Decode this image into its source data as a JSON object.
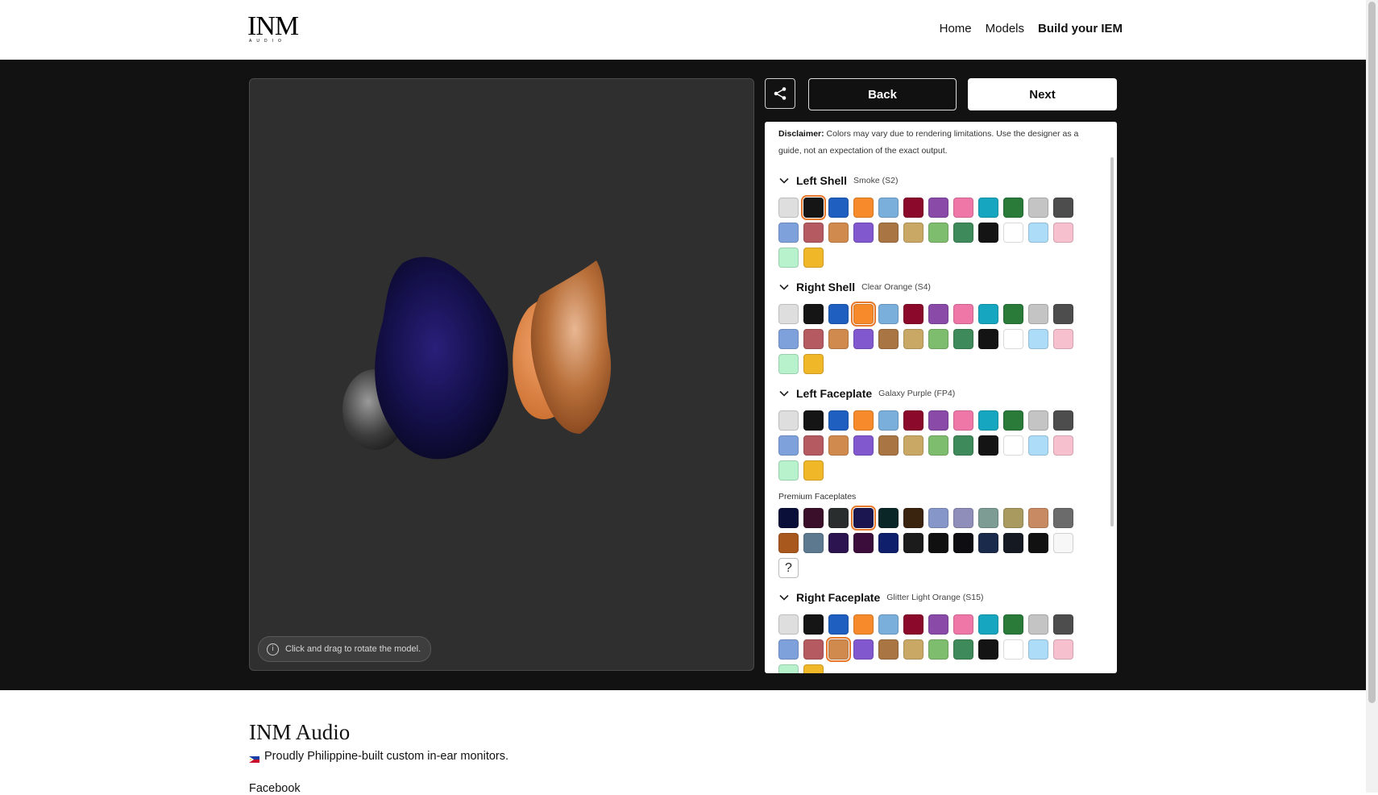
{
  "header": {
    "logo_text": "INM",
    "logo_sub": "AUDIO",
    "nav": [
      "Home",
      "Models",
      "Build your IEM"
    ],
    "active_nav": "Build your IEM"
  },
  "viewer": {
    "hint": "Click and drag to rotate the model."
  },
  "actions": {
    "back": "Back",
    "next": "Next"
  },
  "panel": {
    "disclaimer_label": "Disclaimer:",
    "disclaimer_text": " Colors may vary due to rendering limitations. Use the designer as a guide, not an expectation of the exact output.",
    "premium_label": "Premium Faceplates",
    "premium_unknown": "?",
    "sections": [
      {
        "title": "Left Shell",
        "value": "Smoke (S2)",
        "selected": 1
      },
      {
        "title": "Right Shell",
        "value": "Clear Orange (S4)",
        "selected": 3
      },
      {
        "title": "Left Faceplate",
        "value": "Galaxy Purple (FP4)",
        "premium_selected": 3
      },
      {
        "title": "Right Faceplate",
        "value": "Glitter Light Orange (S15)",
        "selected": 14
      }
    ]
  },
  "colors": {
    "standard": [
      "#dedede",
      "#151515",
      "#1f5fc0",
      "#f78a2a",
      "#7aaedb",
      "#8b0a2b",
      "#8a4aa8",
      "#ef77a8",
      "#16a6bf",
      "#2a7a3a",
      "#c4c4c4",
      "#4d4d4d",
      "#7ea1dc",
      "#b45a60",
      "#d08a4d",
      "#8258cf",
      "#a87543",
      "#c9a865",
      "#7fbd6e",
      "#3f8a5a",
      "#141414",
      "#ffffff",
      "#addcf8",
      "#f6c0cf",
      "#b7f2cd",
      "#f0b729"
    ],
    "premium": [
      "#0a0f3a",
      "#3a0f2a",
      "#2a2d2d",
      "#1b1650",
      "#0b2626",
      "#3a2410",
      "#8796c8",
      "#8f8db9",
      "#7c9c94",
      "#a99a60",
      "#c88a62",
      "#6b6b6b",
      "#a8581c",
      "#5d7990",
      "#2b1450",
      "#3a0d3a",
      "#0f1f6b",
      "#1b1b1b",
      "#101010",
      "#0d0d12",
      "#1a2a4a",
      "#151a22",
      "#111111",
      "#f7f7f7"
    ],
    "accent": "#e8782a"
  },
  "footer": {
    "title": "INM Audio",
    "tagline": "Proudly Philippine-built custom in-ear monitors.",
    "link": "Facebook"
  }
}
